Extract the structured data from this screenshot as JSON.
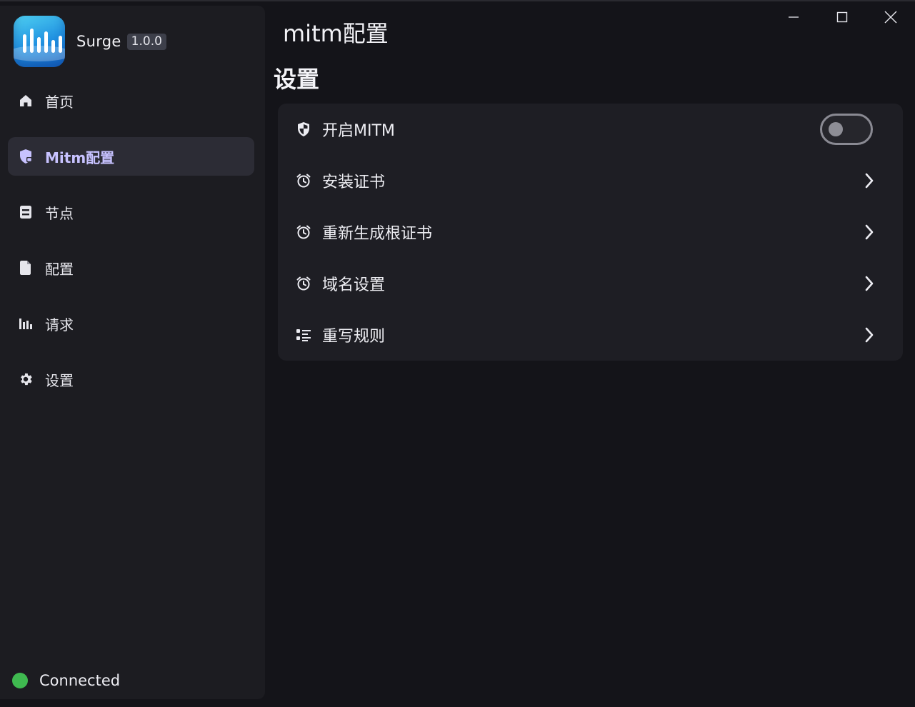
{
  "app": {
    "name": "Surge",
    "version": "1.0.0"
  },
  "sidebar": {
    "items": [
      {
        "label": "首页",
        "icon": "home-icon",
        "active": false
      },
      {
        "label": "Mitm配置",
        "icon": "shield-lock-icon",
        "active": true
      },
      {
        "label": "节点",
        "icon": "server-icon",
        "active": false
      },
      {
        "label": "配置",
        "icon": "file-icon",
        "active": false
      },
      {
        "label": "请求",
        "icon": "bar-chart-icon",
        "active": false
      },
      {
        "label": "设置",
        "icon": "gear-icon",
        "active": false
      }
    ],
    "status": {
      "label": "Connected",
      "color": "#3fb950"
    }
  },
  "header": {
    "title": "mitm配置"
  },
  "main": {
    "section_title": "设置",
    "rows": [
      {
        "label": "开启MITM",
        "icon": "shield-icon",
        "control": "toggle",
        "checked": false
      },
      {
        "label": "安装证书",
        "icon": "alarm-clock-icon",
        "control": "chevron"
      },
      {
        "label": "重新生成根证书",
        "icon": "alarm-clock-icon",
        "control": "chevron"
      },
      {
        "label": "域名设置",
        "icon": "alarm-clock-icon",
        "control": "chevron"
      },
      {
        "label": "重写规则",
        "icon": "list-icon",
        "control": "chevron"
      }
    ]
  },
  "colors": {
    "accent": "#c7c2ff",
    "background": "#141419",
    "sidebar": "#1c1c21",
    "card": "#1e1e24"
  }
}
